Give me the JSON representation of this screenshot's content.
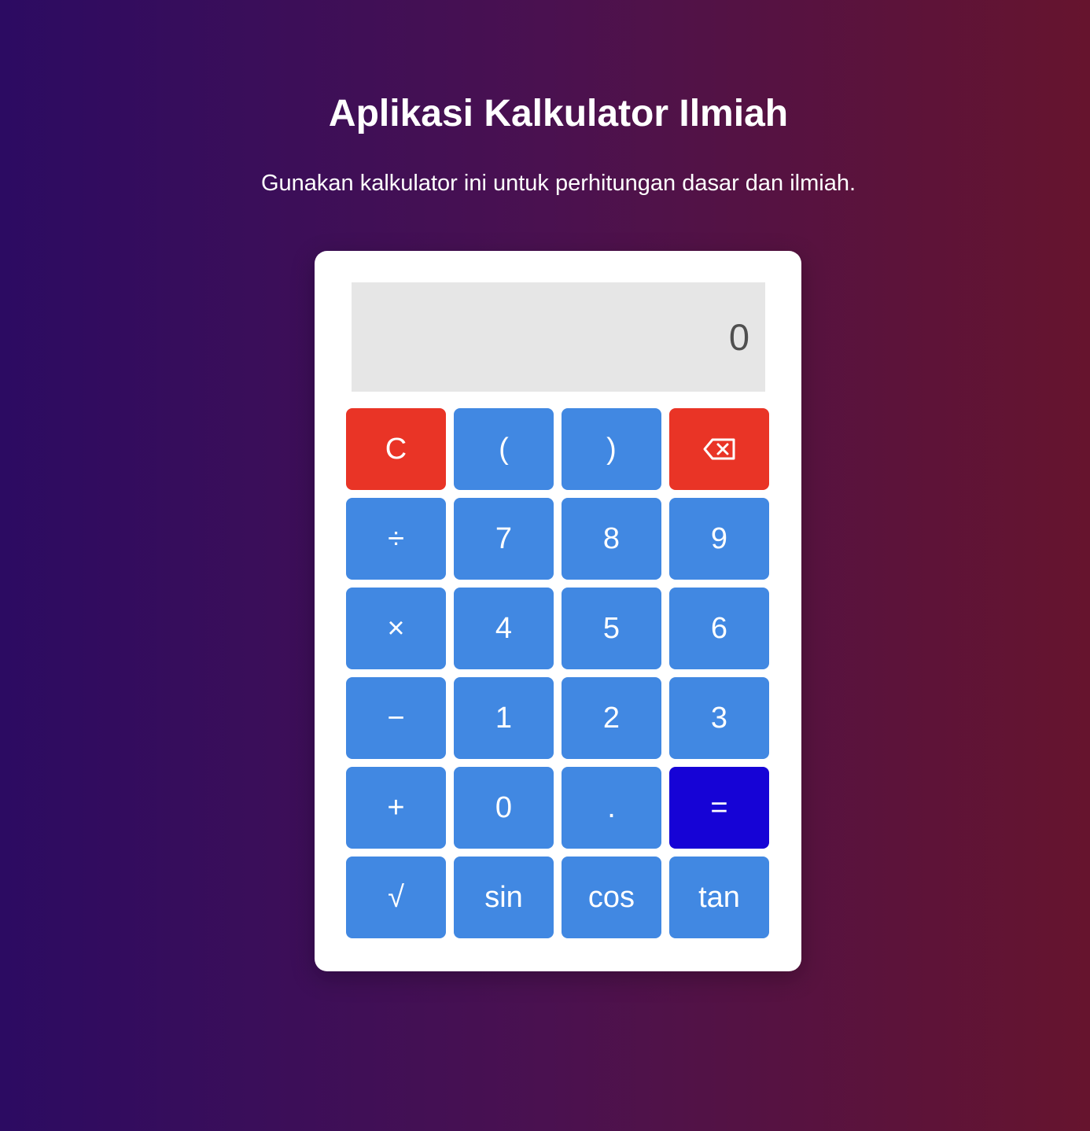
{
  "header": {
    "title": "Aplikasi Kalkulator Ilmiah",
    "subtitle": "Gunakan kalkulator ini untuk perhitungan dasar dan ilmiah."
  },
  "display": {
    "value": "0"
  },
  "keys": {
    "clear": "C",
    "paren_open": "(",
    "paren_close": ")",
    "backspace_icon": "backspace-icon",
    "divide": "÷",
    "seven": "7",
    "eight": "8",
    "nine": "9",
    "multiply": "×",
    "four": "4",
    "five": "5",
    "six": "6",
    "subtract": "−",
    "one": "1",
    "two": "2",
    "three": "3",
    "add": "+",
    "zero": "0",
    "decimal": ".",
    "equals": "=",
    "sqrt": "√",
    "sin": "sin",
    "cos": "cos",
    "tan": "tan"
  },
  "colors": {
    "key_default": "#4188e2",
    "key_danger": "#e93426",
    "key_equals": "#1603d6",
    "display_bg": "#e6e6e6"
  }
}
